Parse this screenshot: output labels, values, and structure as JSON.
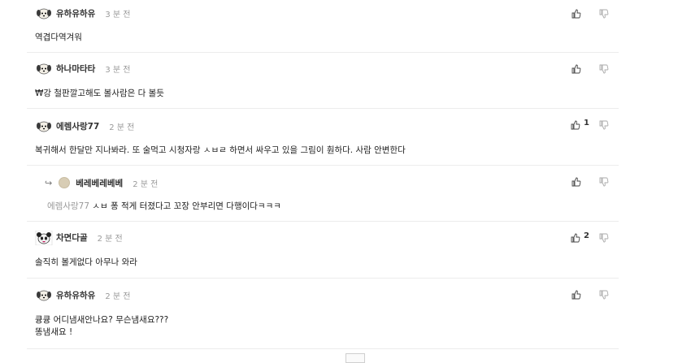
{
  "comments": [
    {
      "nick": "유하유하유",
      "time": "3 분 전",
      "lines": [
        "역겹다역겨워"
      ],
      "up": "",
      "reply": false
    },
    {
      "nick": "하나마타타",
      "time": "3 분 전",
      "lines": [
        "₩강 철판깔고해도 볼사람은 다 볼듯"
      ],
      "up": "",
      "reply": false
    },
    {
      "nick": "에렘사랑77",
      "time": "2 분 전",
      "lines": [
        "복귀해서 한달만 지나봐라. 또 술먹고 시청자랑 ㅅㅂㄹ 하면서 싸우고 있을 그림이 훤하다. 사람 안변한다"
      ],
      "up": "1",
      "reply": false
    },
    {
      "nick": "베레베레베베",
      "time": "2 분 전",
      "mention": "에렘사랑77",
      "lines": [
        "ㅅㅂ 퐁 적게 터졌다고 꼬장 안부리면 다행이다ㅋㅋㅋ"
      ],
      "up": "",
      "reply": true,
      "reply_arrow": "↪"
    },
    {
      "nick": "차면다골",
      "time": "2 분 전",
      "lines": [
        "솔직히 볼게없다 아무나 와라"
      ],
      "up": "2",
      "reply": false
    },
    {
      "nick": "유하유하유",
      "time": "2 분 전",
      "lines": [
        "큥큥 어디냄새안나요? 무슨냄새요???",
        "똥냄새요 !"
      ],
      "up": "",
      "reply": false
    }
  ],
  "icons": {
    "up": "thumbs-up-icon",
    "down": "thumbs-down-icon",
    "avatar": "puppy-avatar-icon"
  }
}
